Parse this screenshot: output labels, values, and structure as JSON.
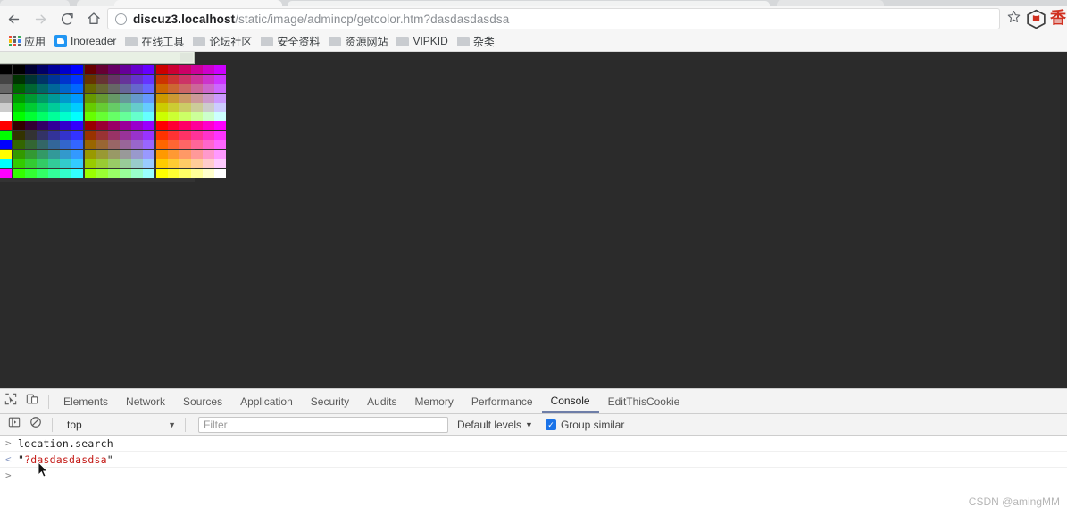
{
  "browser": {
    "nav": {
      "back_icon": "arrow-left-icon",
      "forward_icon": "arrow-right-icon",
      "reload_icon": "reload-icon",
      "home_icon": "home-icon"
    },
    "omnibox": {
      "security_icon": "info-circle-icon",
      "host": "discuz3.localhost",
      "path": "/static/image/admincp/getcolor.htm?dasdasdasdsa",
      "full_url": "discuz3.localhost/static/image/admincp/getcolor.htm?dasdasdasdsa"
    },
    "star_icon": "bookmark-star-icon",
    "extension_1_icon": "cube-extension-icon",
    "extension_2_icon": "red-extension-icon",
    "bookmarks": [
      {
        "label": "应用",
        "icon": "apps-grid-icon"
      },
      {
        "label": "Inoreader",
        "icon": "inoreader-icon"
      },
      {
        "label": "在线工具",
        "icon": "folder-icon"
      },
      {
        "label": "论坛社区",
        "icon": "folder-icon"
      },
      {
        "label": "安全资料",
        "icon": "folder-icon"
      },
      {
        "label": "资源网站",
        "icon": "folder-icon"
      },
      {
        "label": "VIPKID",
        "icon": "folder-icon"
      },
      {
        "label": "杂类",
        "icon": "folder-icon"
      }
    ]
  },
  "page": {
    "background_color": "#2b2b2b",
    "palette": {
      "preview_value": "",
      "columns_first": [
        "#000000",
        "#444444",
        "#666666",
        "#999999",
        "#cccccc",
        "#ffffff",
        "#ff0000",
        "#00ff00",
        "#0000ff",
        "#ffff00",
        "#00ffff",
        "#ff00ff"
      ],
      "groups": [
        {
          "base": "#000000",
          "rows": [
            [
              "#000000",
              "#000033",
              "#000066",
              "#000099",
              "#0000cc",
              "#0000ff"
            ],
            [
              "#003300",
              "#003333",
              "#003366",
              "#003399",
              "#0033cc",
              "#0033ff"
            ],
            [
              "#006600",
              "#006633",
              "#006666",
              "#006699",
              "#0066cc",
              "#0066ff"
            ],
            [
              "#009900",
              "#009933",
              "#009966",
              "#009999",
              "#0099cc",
              "#0099ff"
            ],
            [
              "#00cc00",
              "#00cc33",
              "#00cc66",
              "#00cc99",
              "#00cccc",
              "#00ccff"
            ],
            [
              "#00ff00",
              "#00ff33",
              "#00ff66",
              "#00ff99",
              "#00ffcc",
              "#00ffff"
            ],
            [
              "#330000",
              "#330033",
              "#330066",
              "#330099",
              "#3300cc",
              "#3300ff"
            ],
            [
              "#333300",
              "#333333",
              "#333366",
              "#333399",
              "#3333cc",
              "#3333ff"
            ],
            [
              "#336600",
              "#336633",
              "#336666",
              "#336699",
              "#3366cc",
              "#3366ff"
            ],
            [
              "#339900",
              "#339933",
              "#339966",
              "#339999",
              "#3399cc",
              "#3399ff"
            ],
            [
              "#33cc00",
              "#33cc33",
              "#33cc66",
              "#33cc99",
              "#33cccc",
              "#33ccff"
            ],
            [
              "#33ff00",
              "#33ff33",
              "#33ff66",
              "#33ff99",
              "#33ffcc",
              "#33ffff"
            ]
          ]
        },
        {
          "base": "#660000",
          "rows": [
            [
              "#660000",
              "#660033",
              "#660066",
              "#660099",
              "#6600cc",
              "#6600ff"
            ],
            [
              "#663300",
              "#663333",
              "#663366",
              "#663399",
              "#6633cc",
              "#6633ff"
            ],
            [
              "#666600",
              "#666633",
              "#666666",
              "#666699",
              "#6666cc",
              "#6666ff"
            ],
            [
              "#669900",
              "#669933",
              "#669966",
              "#669999",
              "#6699cc",
              "#6699ff"
            ],
            [
              "#66cc00",
              "#66cc33",
              "#66cc66",
              "#66cc99",
              "#66cccc",
              "#66ccff"
            ],
            [
              "#66ff00",
              "#66ff33",
              "#66ff66",
              "#66ff99",
              "#66ffcc",
              "#66ffff"
            ],
            [
              "#990000",
              "#990033",
              "#990066",
              "#990099",
              "#9900cc",
              "#9900ff"
            ],
            [
              "#993300",
              "#993333",
              "#993366",
              "#993399",
              "#9933cc",
              "#9933ff"
            ],
            [
              "#996600",
              "#996633",
              "#996666",
              "#996699",
              "#9966cc",
              "#9966ff"
            ],
            [
              "#999900",
              "#999933",
              "#999966",
              "#999999",
              "#9999cc",
              "#9999ff"
            ],
            [
              "#99cc00",
              "#99cc33",
              "#99cc66",
              "#99cc99",
              "#99cccc",
              "#99ccff"
            ],
            [
              "#99ff00",
              "#99ff33",
              "#99ff66",
              "#99ff99",
              "#99ffcc",
              "#99ffff"
            ]
          ]
        },
        {
          "base": "#cc0000",
          "rows": [
            [
              "#cc0000",
              "#cc0033",
              "#cc0066",
              "#cc0099",
              "#cc00cc",
              "#cc00ff"
            ],
            [
              "#cc3300",
              "#cc3333",
              "#cc3366",
              "#cc3399",
              "#cc33cc",
              "#cc33ff"
            ],
            [
              "#cc6600",
              "#cc6633",
              "#cc6666",
              "#cc6699",
              "#cc66cc",
              "#cc66ff"
            ],
            [
              "#cc9900",
              "#cc9933",
              "#cc9966",
              "#cc9999",
              "#cc99cc",
              "#cc99ff"
            ],
            [
              "#cccc00",
              "#cccc33",
              "#cccc66",
              "#cccc99",
              "#cccccc",
              "#ccccff"
            ],
            [
              "#ccff00",
              "#ccff33",
              "#ccff66",
              "#ccff99",
              "#ccffcc",
              "#ccffff"
            ],
            [
              "#ff0000",
              "#ff0033",
              "#ff0066",
              "#ff0099",
              "#ff00cc",
              "#ff00ff"
            ],
            [
              "#ff3300",
              "#ff3333",
              "#ff3366",
              "#ff3399",
              "#ff33cc",
              "#ff33ff"
            ],
            [
              "#ff6600",
              "#ff6633",
              "#ff6666",
              "#ff6699",
              "#ff66cc",
              "#ff66ff"
            ],
            [
              "#ff9900",
              "#ff9933",
              "#ff9966",
              "#ff9999",
              "#ff99cc",
              "#ff99ff"
            ],
            [
              "#ffcc00",
              "#ffcc33",
              "#ffcc66",
              "#ffcc99",
              "#ffcccc",
              "#ffccff"
            ],
            [
              "#ffff00",
              "#ffff33",
              "#ffff66",
              "#ffff99",
              "#ffffcc",
              "#ffffff"
            ]
          ]
        }
      ]
    }
  },
  "devtools": {
    "inspect_icon": "inspect-element-icon",
    "device_icon": "device-toolbar-icon",
    "tabs": [
      {
        "label": "Elements",
        "active": false
      },
      {
        "label": "Network",
        "active": false
      },
      {
        "label": "Sources",
        "active": false
      },
      {
        "label": "Application",
        "active": false
      },
      {
        "label": "Security",
        "active": false
      },
      {
        "label": "Audits",
        "active": false
      },
      {
        "label": "Memory",
        "active": false
      },
      {
        "label": "Performance",
        "active": false
      },
      {
        "label": "Console",
        "active": true
      },
      {
        "label": "EditThisCookie",
        "active": false
      }
    ],
    "console_bar": {
      "sidebar_icon": "console-sidebar-icon",
      "clear_icon": "clear-console-icon",
      "context": "top",
      "context_caret": "▼",
      "filter_placeholder": "Filter",
      "levels_label": "Default levels",
      "levels_caret": "▼",
      "group_similar_label": "Group similar",
      "group_similar_checked": true,
      "checkbox_color": "#1a73e8"
    },
    "console_output": [
      {
        "marker": ">",
        "type": "input",
        "text": "location.search"
      },
      {
        "marker": "<",
        "type": "result",
        "quote": "\"",
        "value": "?dasdasdasdsa",
        "color": "#c41a16"
      },
      {
        "marker": ">",
        "type": "prompt",
        "text": ""
      }
    ]
  },
  "watermark": {
    "text": "CSDN @amingMM"
  }
}
